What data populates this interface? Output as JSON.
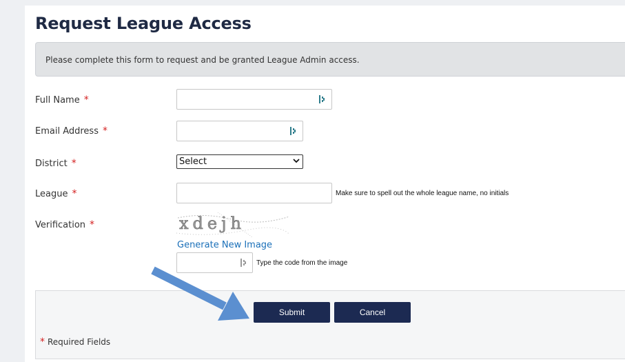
{
  "page": {
    "title": "Request League Access"
  },
  "notice": "Please complete this form to request and be granted League Admin access.",
  "form": {
    "required_mark": "*",
    "full_name": {
      "label": "Full Name",
      "value": ""
    },
    "email": {
      "label": "Email Address",
      "value": ""
    },
    "district": {
      "label": "District",
      "selected": "Select"
    },
    "league": {
      "label": "League",
      "value": "",
      "hint": "Make sure to spell out the whole league name, no initials"
    },
    "verification": {
      "label": "Verification",
      "captcha_text": "xdejh",
      "generate_link": "Generate New Image",
      "code_value": "",
      "hint": "Type the code from the image"
    }
  },
  "actions": {
    "submit": "Submit",
    "cancel": "Cancel"
  },
  "footer": {
    "required_note": "Required Fields"
  },
  "colors": {
    "primary_button": "#1c2a52",
    "link": "#1a6fb8",
    "required": "#d42020",
    "annotation_arrow": "#5b8fd0"
  },
  "icons": {
    "input_key_icon": "password-manager-key-icon",
    "select_chevron": "chevron-down-icon",
    "annotation": "arrow-pointer-icon"
  }
}
